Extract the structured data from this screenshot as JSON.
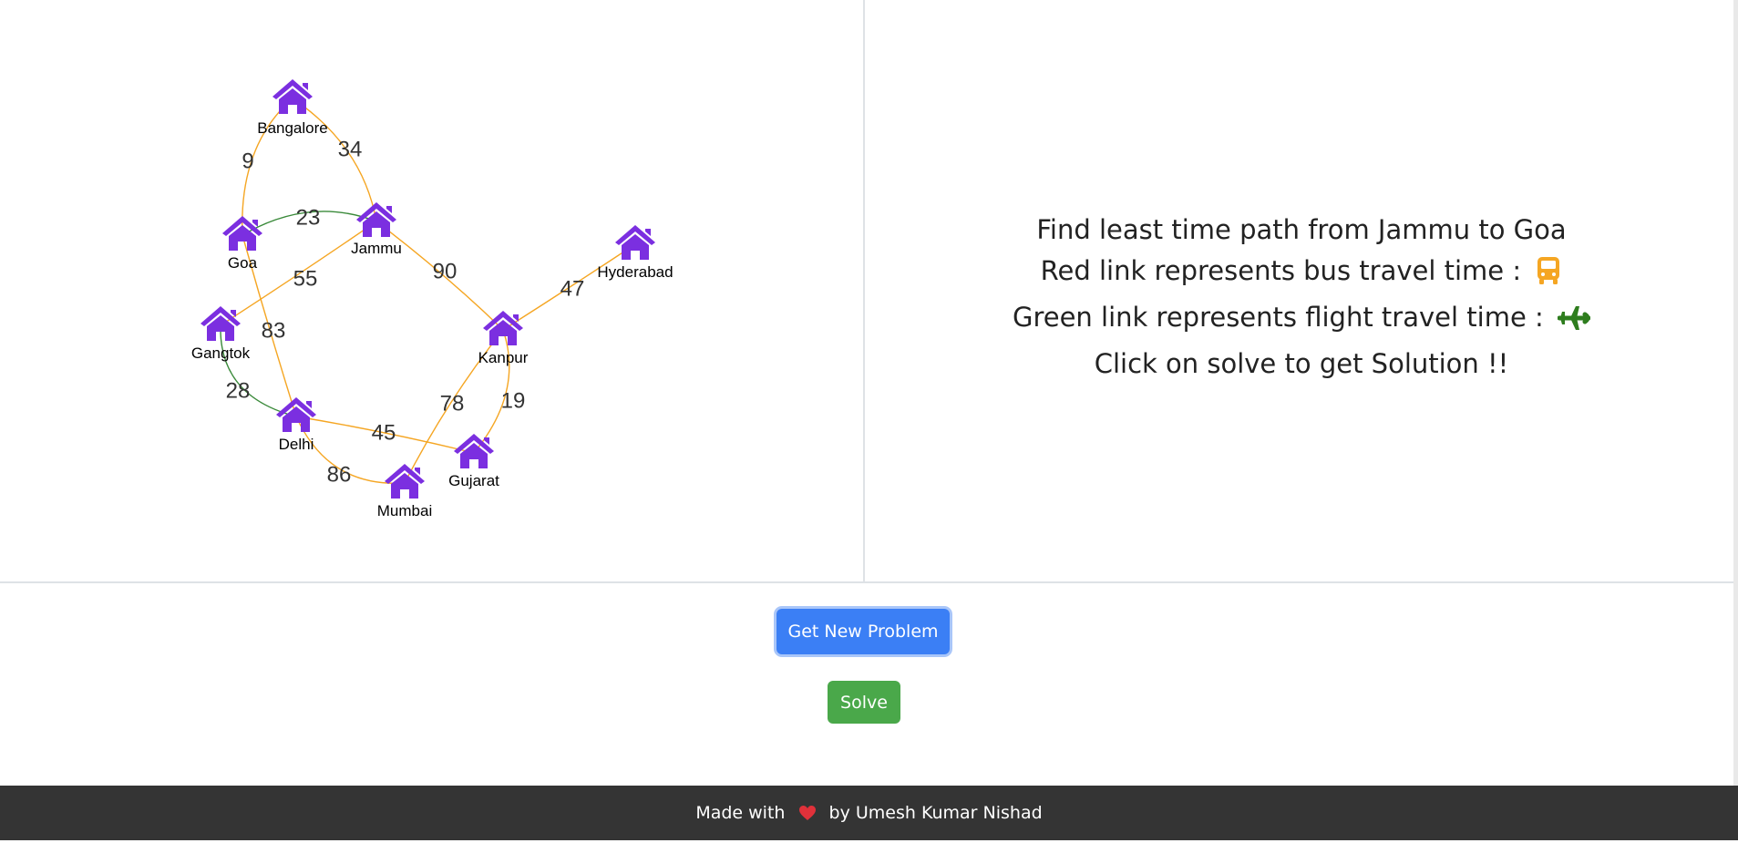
{
  "graph": {
    "nodes": [
      {
        "id": "bangalore",
        "label": "Bangalore"
      },
      {
        "id": "goa",
        "label": "Goa"
      },
      {
        "id": "jammu",
        "label": "Jammu"
      },
      {
        "id": "hyderabad",
        "label": "Hyderabad"
      },
      {
        "id": "gangtok",
        "label": "Gangtok"
      },
      {
        "id": "kanpur",
        "label": "Kanpur"
      },
      {
        "id": "delhi",
        "label": "Delhi"
      },
      {
        "id": "gujarat",
        "label": "Gujarat"
      },
      {
        "id": "mumbai",
        "label": "Mumbai"
      }
    ],
    "edges": [
      {
        "from": "bangalore",
        "to": "goa",
        "weight": "9",
        "mode": "bus"
      },
      {
        "from": "bangalore",
        "to": "jammu",
        "weight": "34",
        "mode": "bus"
      },
      {
        "from": "goa",
        "to": "jammu",
        "weight": "23",
        "mode": "flight"
      },
      {
        "from": "jammu",
        "to": "gangtok",
        "weight": "55",
        "mode": "bus"
      },
      {
        "from": "jammu",
        "to": "kanpur",
        "weight": "90",
        "mode": "bus"
      },
      {
        "from": "hyderabad",
        "to": "kanpur",
        "weight": "47",
        "mode": "bus"
      },
      {
        "from": "goa",
        "to": "delhi",
        "weight": "83",
        "mode": "bus"
      },
      {
        "from": "gangtok",
        "to": "delhi",
        "weight": "28",
        "mode": "flight"
      },
      {
        "from": "delhi",
        "to": "gujarat",
        "weight": "45",
        "mode": "bus"
      },
      {
        "from": "delhi",
        "to": "mumbai",
        "weight": "86",
        "mode": "bus"
      },
      {
        "from": "kanpur",
        "to": "mumbai",
        "weight": "78",
        "mode": "bus"
      },
      {
        "from": "kanpur",
        "to": "gujarat",
        "weight": "19",
        "mode": "bus"
      }
    ],
    "colors": {
      "node": "#7b2fe0",
      "bus_edge": "#f5a623",
      "flight_edge": "#3a8a3a"
    }
  },
  "instructions": {
    "line1": "Find least time path from Jammu to Goa",
    "line2": "Red link represents bus travel time :",
    "line2_icon": "bus-icon",
    "line3": "Green link represents flight travel time :",
    "line3_icon": "airplane-icon",
    "line4": "Click on solve to get Solution !!"
  },
  "buttons": {
    "new_problem": "Get New Problem",
    "solve": "Solve"
  },
  "footer": {
    "prefix": "Made with",
    "icon": "heart-icon",
    "suffix": "by Umesh Kumar Nishad"
  }
}
